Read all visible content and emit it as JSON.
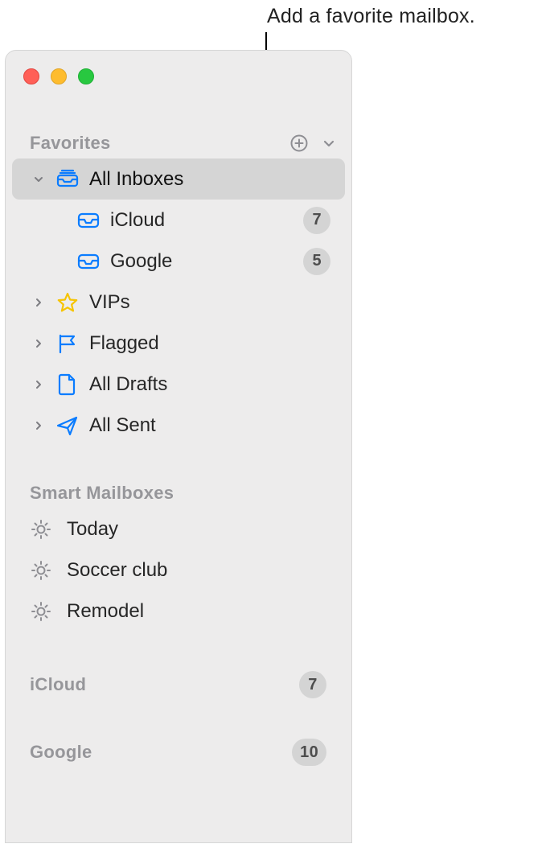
{
  "callout": {
    "text": "Add a favorite mailbox."
  },
  "sections": {
    "favorites": {
      "header": "Favorites",
      "items": [
        {
          "label": "All Inboxes",
          "selected": true
        },
        {
          "label": "iCloud",
          "count": "7"
        },
        {
          "label": "Google",
          "count": "5"
        },
        {
          "label": "VIPs"
        },
        {
          "label": "Flagged"
        },
        {
          "label": "All Drafts"
        },
        {
          "label": "All Sent"
        }
      ]
    },
    "smart": {
      "header": "Smart Mailboxes",
      "items": [
        {
          "label": "Today"
        },
        {
          "label": "Soccer club"
        },
        {
          "label": "Remodel"
        }
      ]
    },
    "accounts": [
      {
        "label": "iCloud",
        "count": "7"
      },
      {
        "label": "Google",
        "count": "10"
      }
    ]
  }
}
